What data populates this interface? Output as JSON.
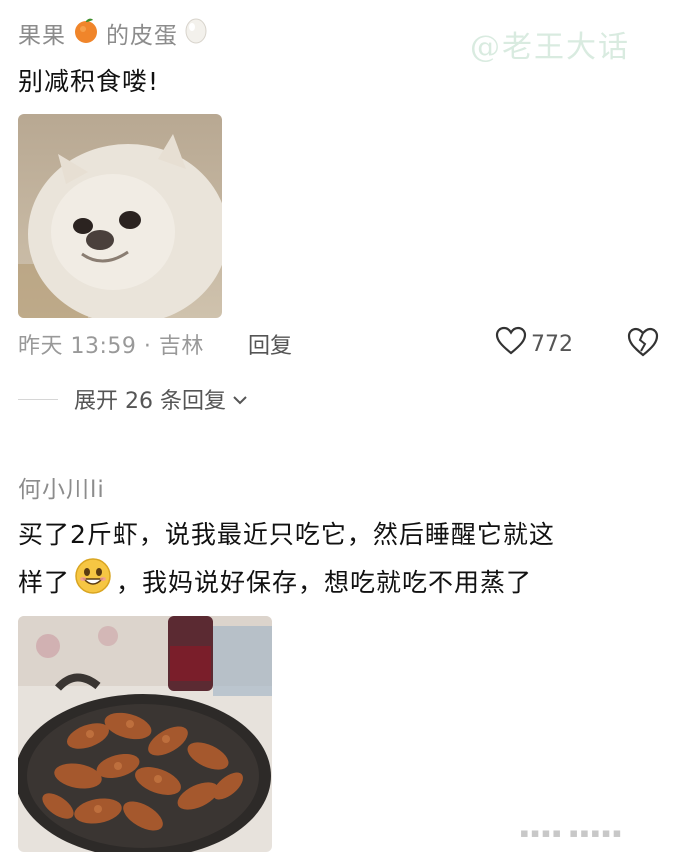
{
  "comments": [
    {
      "username_part1": "果果",
      "username_part2": "的皮蛋",
      "text": "别减积食喽!",
      "image_icon": "dog-photo",
      "meta": "昨天 13:59 · 吉林",
      "reply_label": "回复",
      "like_count": "772",
      "expand_label": "展开 26 条回复"
    },
    {
      "username": "何小川li",
      "text_line1": "买了2斤虾，说我最近只吃它，然后睡醒它就这",
      "text_line2_before": "样了",
      "text_line2_after": "，我妈说好保存，想吃就吃不用蒸了",
      "image_icon": "shrimp-pan-photo"
    }
  ],
  "watermark": "@老王大话",
  "icons": [
    "orange-icon",
    "egg-icon",
    "heart-outline-icon",
    "broken-heart-icon",
    "chevron-down-icon",
    "grin-emoji-icon"
  ]
}
